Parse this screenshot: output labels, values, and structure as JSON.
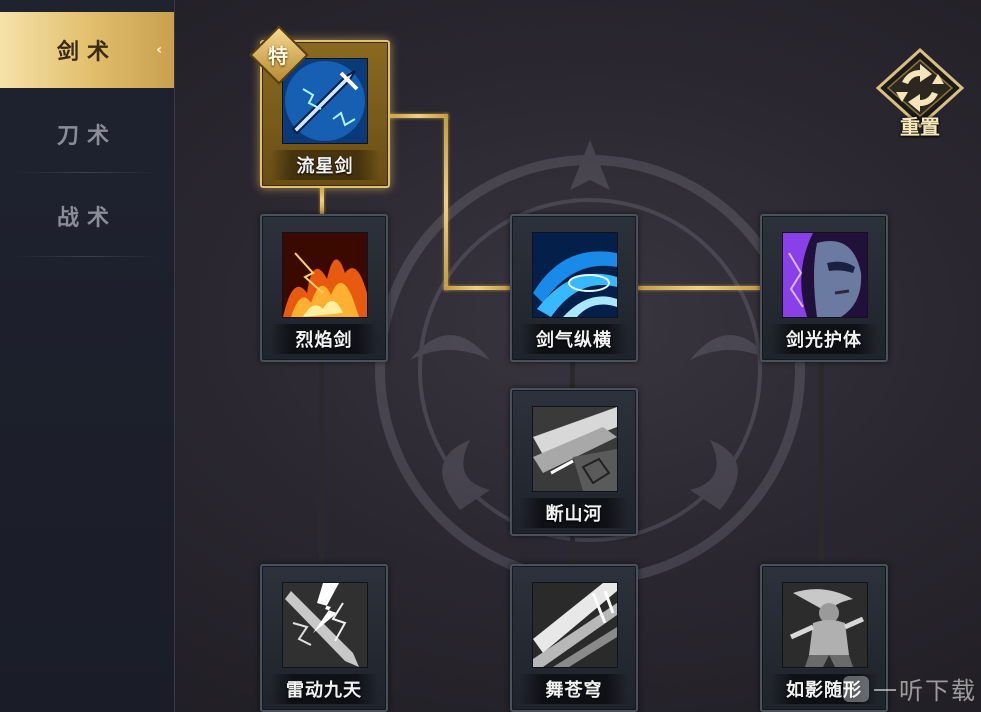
{
  "sidebar": {
    "tabs": [
      {
        "label": "剑术",
        "active": true
      },
      {
        "label": "刀术",
        "active": false
      },
      {
        "label": "战术",
        "active": false
      }
    ]
  },
  "special_badge": "特",
  "reset": {
    "label": "重置",
    "icon": "cycle-arrows-icon"
  },
  "skills": {
    "liuxingjian": {
      "name": "流星剑",
      "selected": true,
      "icon": "blue-lightning-sword-icon"
    },
    "lieyanjian": {
      "name": "烈焰剑",
      "selected": false,
      "icon": "flame-icon"
    },
    "jianqizongheng": {
      "name": "剑气纵横",
      "selected": false,
      "icon": "blue-swirl-icon"
    },
    "jianguanghuti": {
      "name": "剑光护体",
      "selected": false,
      "icon": "purple-masked-face-icon"
    },
    "duanshanhe": {
      "name": "断山河",
      "selected": false,
      "icon": "slash-rock-icon"
    },
    "leidongjiutian": {
      "name": "雷动九天",
      "selected": false,
      "icon": "white-lightning-icon"
    },
    "wucangqiong": {
      "name": "舞苍穹",
      "selected": false,
      "icon": "sword-rain-icon"
    },
    "ruyingsuixing": {
      "name": "如影随形",
      "selected": false,
      "icon": "shadow-warrior-icon"
    }
  },
  "watermark": "一听下载",
  "colors": {
    "gold": "#e4c26c",
    "card_border": "#4a505c",
    "active_tab": "#e0bd6a"
  }
}
